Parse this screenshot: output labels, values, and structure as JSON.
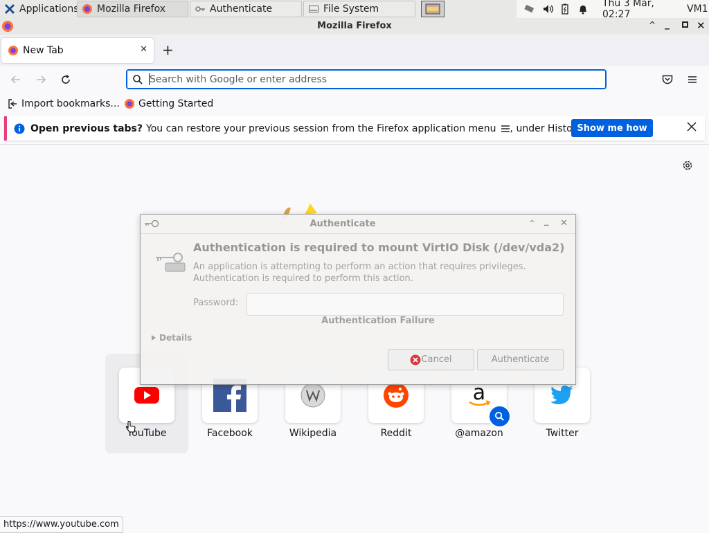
{
  "panel": {
    "applications_label": "Applications",
    "tasks": [
      {
        "label": "Mozilla Firefox"
      },
      {
        "label": "Authenticate"
      },
      {
        "label": "File System"
      }
    ],
    "clock": "Thu  3 Mar, 02:27",
    "user": "VM1"
  },
  "window": {
    "title": "Mozilla Firefox"
  },
  "tab": {
    "label": "New Tab"
  },
  "urlbar": {
    "placeholder": "Search with Google or enter address"
  },
  "bookmarks": [
    {
      "label": "Import bookmarks..."
    },
    {
      "label": "Getting Started"
    }
  ],
  "infobar": {
    "bold": "Open previous tabs?",
    "text_before_icon": "You can restore your previous session from the Firefox application menu",
    "text_after_icon": ", under History.",
    "button": "Show me how"
  },
  "top_sites": [
    {
      "label": "YouTube",
      "color": "#ff0000"
    },
    {
      "label": "Facebook",
      "color": "#1877f2"
    },
    {
      "label": "Wikipedia",
      "color": "#888888"
    },
    {
      "label": "Reddit",
      "color": "#ff4500"
    },
    {
      "label": "@amazon",
      "color": "#232f3e"
    },
    {
      "label": "Twitter",
      "color": "#1da1f2"
    }
  ],
  "dialog": {
    "title": "Authenticate",
    "heading": "Authentication is required to mount VirtIO Disk (/dev/vda2)",
    "line1": "An application is attempting to perform an action that requires privileges.",
    "line2": "Authentication is required to perform this action.",
    "password_label": "Password:",
    "failure": "Authentication Failure",
    "details": "Details",
    "cancel": "Cancel",
    "authenticate": "Authenticate"
  },
  "status": {
    "url": "https://www.youtube.com"
  },
  "colors": {
    "accent": "#0061e0",
    "infobar_stripe": "#e5407a"
  }
}
